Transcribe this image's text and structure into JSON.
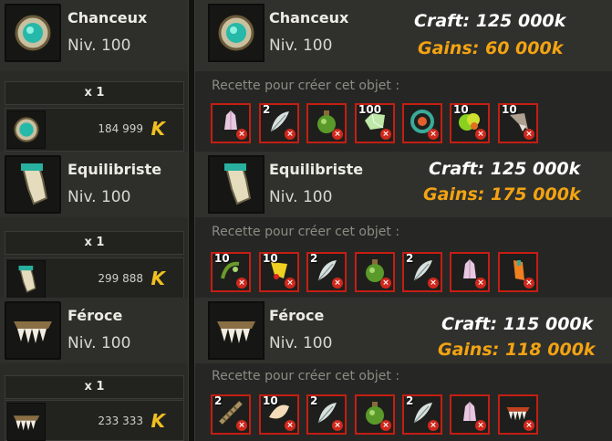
{
  "items": [
    {
      "name": "Chanceux",
      "level": "Niv. 100",
      "qty": "x 1",
      "price": "184 999",
      "craft": "Craft: 125 000k",
      "gains": "Gains: 60 000k",
      "recipe_label": "Recette pour créer cet objet :",
      "ingredients": [
        {
          "qty": "",
          "icon": "pink-crystal-icon"
        },
        {
          "qty": "2",
          "icon": "feather-icon"
        },
        {
          "qty": "",
          "icon": "green-potion-icon"
        },
        {
          "qty": "100",
          "icon": "green-gem-icon"
        },
        {
          "qty": "",
          "icon": "ring-icon"
        },
        {
          "qty": "10",
          "icon": "green-resource-icon"
        },
        {
          "qty": "10",
          "icon": "claw-icon"
        }
      ]
    },
    {
      "name": "Equilibriste",
      "level": "Niv. 100",
      "qty": "x 1",
      "price": "299 888",
      "craft": "Craft: 125 000k",
      "gains": "Gains:  175 000k",
      "recipe_label": "Recette pour créer cet objet :",
      "ingredients": [
        {
          "qty": "10",
          "icon": "vine-icon"
        },
        {
          "qty": "10",
          "icon": "yellow-flower-icon"
        },
        {
          "qty": "2",
          "icon": "feather-icon"
        },
        {
          "qty": "",
          "icon": "green-potion-icon"
        },
        {
          "qty": "2",
          "icon": "feather-icon"
        },
        {
          "qty": "",
          "icon": "pink-crystal-icon"
        },
        {
          "qty": "",
          "icon": "orange-charm-icon"
        }
      ]
    },
    {
      "name": "Féroce",
      "level": "Niv. 100",
      "qty": "x 1",
      "price": "233 333",
      "craft": "Craft: 115 000k",
      "gains": "Gains: 118 000k",
      "recipe_label": "Recette pour créer cet objet :",
      "ingredients": [
        {
          "qty": "2",
          "icon": "rope-icon"
        },
        {
          "qty": "10",
          "icon": "tooth-icon"
        },
        {
          "qty": "2",
          "icon": "feather-icon"
        },
        {
          "qty": "",
          "icon": "green-potion-icon"
        },
        {
          "qty": "2",
          "icon": "feather-icon"
        },
        {
          "qty": "",
          "icon": "pink-crystal-icon"
        },
        {
          "qty": "",
          "icon": "jaw-icon"
        }
      ]
    }
  ],
  "currency_icon": "kama-icon",
  "colors": {
    "craft": "#ffffff",
    "gains": "#f3a312",
    "slot_border": "#c41e14",
    "kama": "#f0c020"
  }
}
